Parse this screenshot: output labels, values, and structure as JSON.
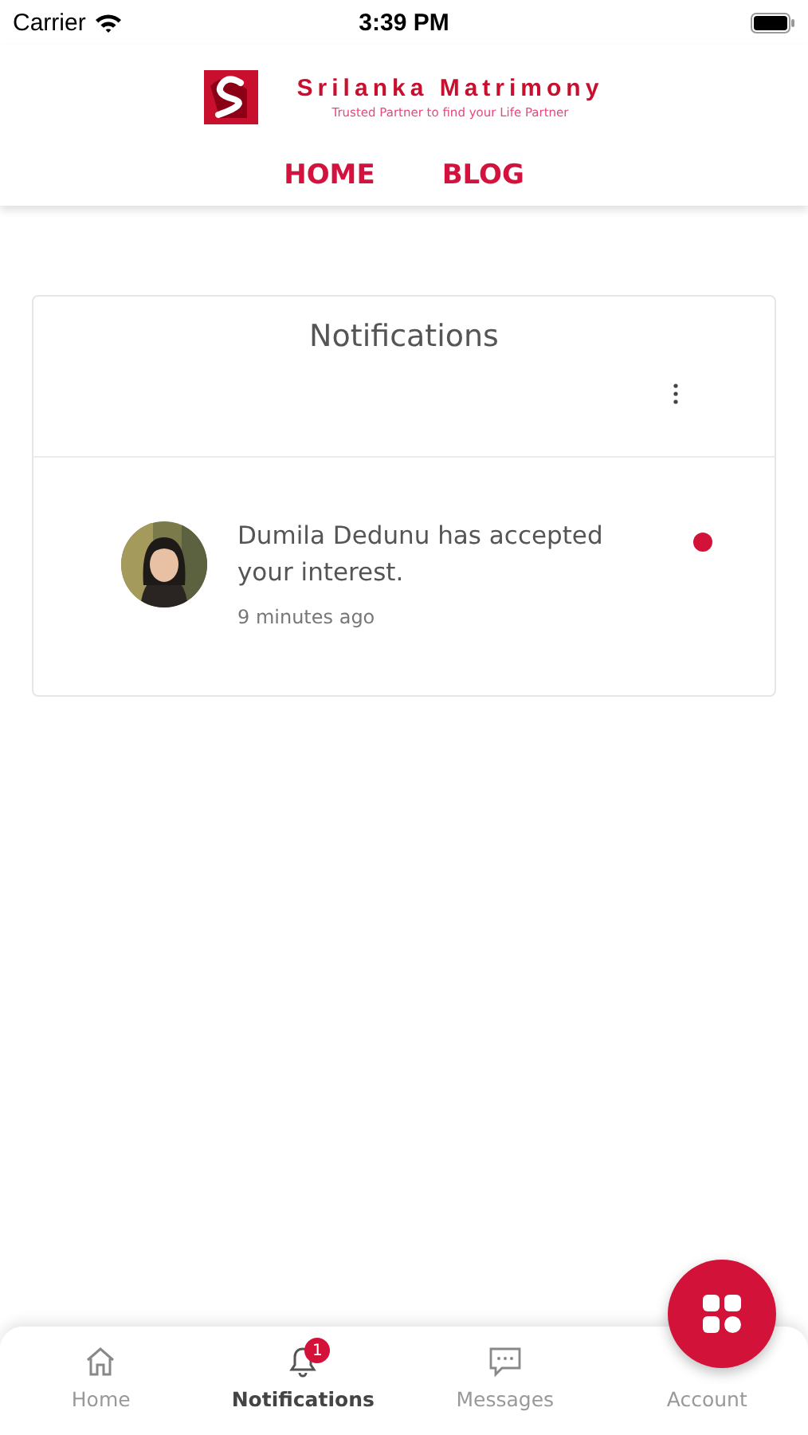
{
  "status_bar": {
    "carrier": "Carrier",
    "time": "3:39 PM"
  },
  "header": {
    "brand": "Srilanka Matrimony",
    "tagline": "Trusted Partner to find your Life Partner",
    "nav": [
      {
        "label": "HOME"
      },
      {
        "label": "BLOG"
      }
    ]
  },
  "notifications": {
    "title": "Notifications",
    "items": [
      {
        "text": "Dumila Dedunu has accepted your interest.",
        "time": "9 minutes ago",
        "unread": true
      }
    ]
  },
  "tab_bar": [
    {
      "label": "Home",
      "kind": "home",
      "selected": false
    },
    {
      "label": "Notifications",
      "kind": "bell",
      "selected": true,
      "badge": "1"
    },
    {
      "label": "Messages",
      "kind": "message",
      "selected": false
    },
    {
      "label": "Account",
      "kind": "plain",
      "selected": false
    }
  ]
}
